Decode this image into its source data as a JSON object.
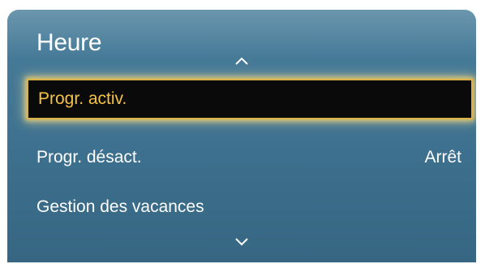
{
  "menu": {
    "title": "Heure",
    "items": [
      {
        "label": "Progr. activ.",
        "value": "",
        "selected": true
      },
      {
        "label": "Progr. désact.",
        "value": "Arrêt",
        "selected": false
      },
      {
        "label": "Gestion des vacances",
        "value": "",
        "selected": false
      }
    ],
    "scroll_up_icon": "chevron-up-icon",
    "scroll_down_icon": "chevron-down-icon"
  },
  "colors": {
    "panel_background": "#3f7391",
    "selected_background": "#0a0a0a",
    "selected_text": "#f5c242",
    "selected_glow": "#f0cd6e",
    "text": "#ffffff"
  }
}
